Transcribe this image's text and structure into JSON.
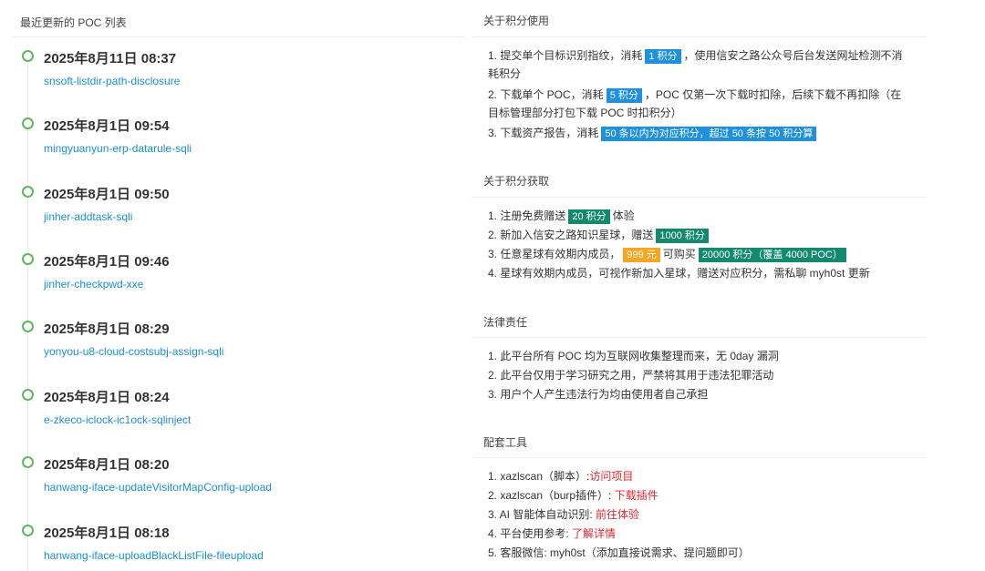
{
  "left": {
    "header": "最近更新的 POC 列表",
    "items": [
      {
        "time": "2025年8月11日 08:37",
        "link": "snsoft-listdir-path-disclosure"
      },
      {
        "time": "2025年8月1日 09:54",
        "link": "mingyuanyun-erp-datarule-sqli"
      },
      {
        "time": "2025年8月1日 09:50",
        "link": "jinher-addtask-sqli"
      },
      {
        "time": "2025年8月1日 09:46",
        "link": "jinher-checkpwd-xxe"
      },
      {
        "time": "2025年8月1日 08:29",
        "link": "yonyou-u8-cloud-costsubj-assign-sqli"
      },
      {
        "time": "2025年8月1日 08:24",
        "link": "e-zkeco-iclock-ic1ock-sqlinject"
      },
      {
        "time": "2025年8月1日 08:20",
        "link": "hanwang-iface-updateVisitorMapConfig-upload"
      },
      {
        "time": "2025年8月1日 08:18",
        "link": "hanwang-iface-uploadBlackListFile-fileupload"
      }
    ]
  },
  "usage": {
    "title": "关于积分使用",
    "l1a": "1. 提交单个目标识别指纹，消耗",
    "l1tag": "1 积分",
    "l1b": "，使用信安之路公众号后台发送网址检测不消",
    "l1c": "耗积分",
    "l2a": "2. 下载单个 POC，消耗",
    "l2tag": "5 积分",
    "l2b": "，POC 仅第一次下载时扣除，后续下载不再扣除（在",
    "l2c": "目标管理部分打包下载 POC 时扣积分）",
    "l3a": "3. 下载资产报告，消耗",
    "l3tag": "50 条以内为对应积分，超过 50 条按 50 积分算"
  },
  "gain": {
    "title": "关于积分获取",
    "l1a": "1. 注册免费赠送",
    "l1tag": "20 积分",
    "l1b": "体验",
    "l2a": "2. 新加入信安之路知识星球，赠送",
    "l2tag": "1000 积分",
    "l3a": "3. 任意星球有效期内成员，",
    "l3tag1": "999 元",
    "l3b": "可购买",
    "l3tag2": "20000 积分（覆盖 4000 POC）",
    "l4": "4. 星球有效期内成员，可视作新加入星球，赠送对应积分，需私聊 myh0st 更新"
  },
  "legal": {
    "title": "法律责任",
    "l1": "1. 此平台所有 POC 均为互联网收集整理而来，无 0day 漏洞",
    "l2": "2. 此平台仅用于学习研究之用，严禁将其用于违法犯罪活动",
    "l3": "3. 用户个人产生违法行为均由使用者自己承担"
  },
  "tools": {
    "title": "配套工具",
    "l1a": "1. xazlscan（脚本）:",
    "l1link": "访问项目",
    "l2a": "2. xazlscan（burp插件）: ",
    "l2link": "下载插件",
    "l3a": "3. AI 智能体自动识别: ",
    "l3link": "前往体验",
    "l4a": "4. 平台使用参考: ",
    "l4link": "了解详情",
    "l5": "5. 客服微信: myh0st（添加直接说需求、提问题即可）"
  },
  "colors": {
    "accent_link": "#1a8fd6",
    "timeline_dot": "#5cb85c",
    "tag_blue": "#1e90e0",
    "tag_green": "#138a6e",
    "tag_orange": "#f5a623",
    "link_red": "#e5262d"
  }
}
